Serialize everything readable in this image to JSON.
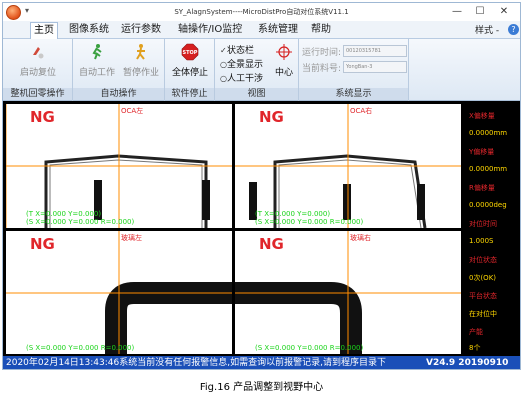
{
  "window": {
    "title": "SY_AlagnSystem----MicroDistPro自动对位系统V11.1",
    "minimize": "—",
    "maximize": "☐",
    "close": "✕"
  },
  "menu": {
    "tabs": [
      "主页",
      "图像系统",
      "运行参数",
      "轴操作/IO监控",
      "系统管理",
      "帮助"
    ],
    "active": "主页",
    "style_label": "样式 -",
    "help_icon": "?"
  },
  "ribbon": {
    "groups": {
      "reset": {
        "label": "整机回零操作",
        "buttons": [
          {
            "label": "启动复位",
            "icon": "reset-icon",
            "enabled": false
          }
        ]
      },
      "auto": {
        "label": "自动操作",
        "buttons": [
          {
            "label": "自动工作",
            "icon": "run-icon",
            "enabled": false
          },
          {
            "label": "暂停作业",
            "icon": "pause-person-icon",
            "enabled": false
          }
        ]
      },
      "software_stop": {
        "label": "软件停止",
        "buttons": [
          {
            "label": "全体停止",
            "icon": "stop-sign-icon",
            "enabled": true
          }
        ]
      },
      "view": {
        "label": "视图",
        "options": [
          {
            "label": "状态栏",
            "mark": "✓"
          },
          {
            "label": "全景显示",
            "mark": "○"
          },
          {
            "label": "人工干涉",
            "mark": "○"
          }
        ],
        "center_button": {
          "label": "中心",
          "icon": "crosshair-icon"
        }
      },
      "system_display": {
        "label": "系统显示",
        "fields": [
          {
            "label": "运行时间:",
            "value": "00120315781"
          },
          {
            "label": "当前料号:",
            "value": "YongBan-3"
          }
        ]
      }
    }
  },
  "cameras": [
    {
      "status": "NG",
      "name": "OCA左",
      "coord_top": "(T X=0.000 Y=0.000)",
      "coord_bottom": "(S X=0.000 Y=0.000 R=0.000)"
    },
    {
      "status": "NG",
      "name": "OCA右",
      "coord_top": "(T X=0.000 Y=0.000)",
      "coord_bottom": "(S X=0.000 Y=0.000 R=0.000)"
    },
    {
      "status": "NG",
      "name": "玻璃左",
      "coord_top": "",
      "coord_bottom": "(S X=0.000 Y=0.000 R=0.000)"
    },
    {
      "status": "NG",
      "name": "玻璃右",
      "coord_top": "",
      "coord_bottom": "(S X=0.000 Y=0.000 R=0.000)"
    }
  ],
  "side_panel": [
    {
      "text": "X偏移量",
      "kind": "label"
    },
    {
      "text": "0.0000mm",
      "kind": "value"
    },
    {
      "text": "Y偏移量",
      "kind": "label"
    },
    {
      "text": "0.0000mm",
      "kind": "value"
    },
    {
      "text": "R偏移量",
      "kind": "label"
    },
    {
      "text": "0.0000deg",
      "kind": "value"
    },
    {
      "text": "对位时间",
      "kind": "label"
    },
    {
      "text": "1.000S",
      "kind": "value"
    },
    {
      "text": "对位状态",
      "kind": "label"
    },
    {
      "text": "0次(OK)",
      "kind": "value"
    },
    {
      "text": "平台状态",
      "kind": "label"
    },
    {
      "text": "在对位中",
      "kind": "value"
    },
    {
      "text": "产能",
      "kind": "label"
    },
    {
      "text": "8个",
      "kind": "value"
    }
  ],
  "status_bar": {
    "message": "2020年02月14日13:43:46系统当前没有任何报警信息,如需查询以前报警记录,请到程序目录下",
    "version": "V24.9  20190910"
  },
  "caption": "Fig.16 产品调整到视野中心",
  "colors": {
    "accent_blue": "#1a4fb8",
    "ng_red": "#e0262b",
    "crosshair_orange": "#ff8c00",
    "coord_green": "#1ad31a",
    "panel_value_yellow": "#ffd700"
  }
}
